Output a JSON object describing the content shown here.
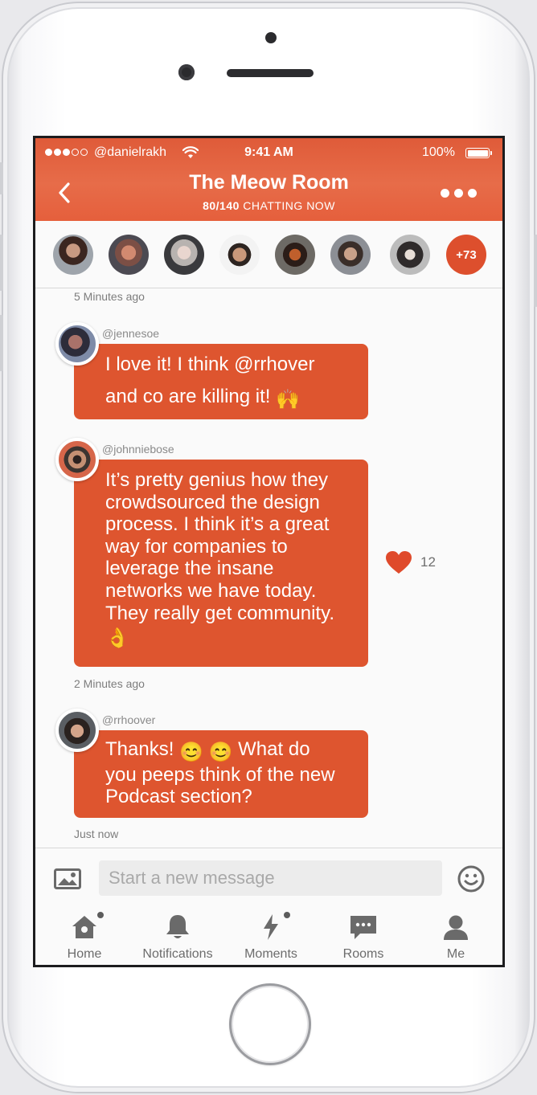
{
  "status_bar": {
    "carrier": "@danielrakh",
    "time": "9:41 AM",
    "battery": "100%"
  },
  "header": {
    "title": "The Meow Room",
    "subtitle_count": "80/140",
    "subtitle_text": "CHATTING NOW",
    "back_icon": "chevron-left-icon",
    "more_icon": "more-horizontal-icon"
  },
  "participants": {
    "extra_count": "+73"
  },
  "messages": [
    {
      "username": "@jennesoe",
      "text": "I love it! I think @rrhover and co are killing it!",
      "emoji": "🙌",
      "likes": null
    },
    {
      "username": "@johnniebose",
      "text": "It’s pretty genius how they crowdsourced the design process. I think it’s a great way for companies to leverage the insane networks we have today. They really get community.",
      "emoji": "👌",
      "likes": "12"
    },
    {
      "username": "@rrhoover",
      "text_before": "Thanks!",
      "emoji": "😊 😊",
      "text_after": "What do you peeps think of the new Podcast section?",
      "likes": null
    }
  ],
  "timestamps": {
    "top": "5 Minutes ago",
    "middle": "2 Minutes ago",
    "bottom": "Just now"
  },
  "composer": {
    "placeholder": "Start a new message",
    "image_icon": "image-icon",
    "emoji_icon": "smile-icon"
  },
  "tabs": [
    {
      "label": "Home",
      "icon": "home-icon"
    },
    {
      "label": "Notifications",
      "icon": "bell-icon"
    },
    {
      "label": "Moments",
      "icon": "lightning-icon"
    },
    {
      "label": "Rooms",
      "icon": "chat-bubble-icon"
    },
    {
      "label": "Me",
      "icon": "person-icon"
    }
  ],
  "colors": {
    "accent": "#de552f",
    "header": "#e4613e",
    "background": "#fafafa"
  }
}
